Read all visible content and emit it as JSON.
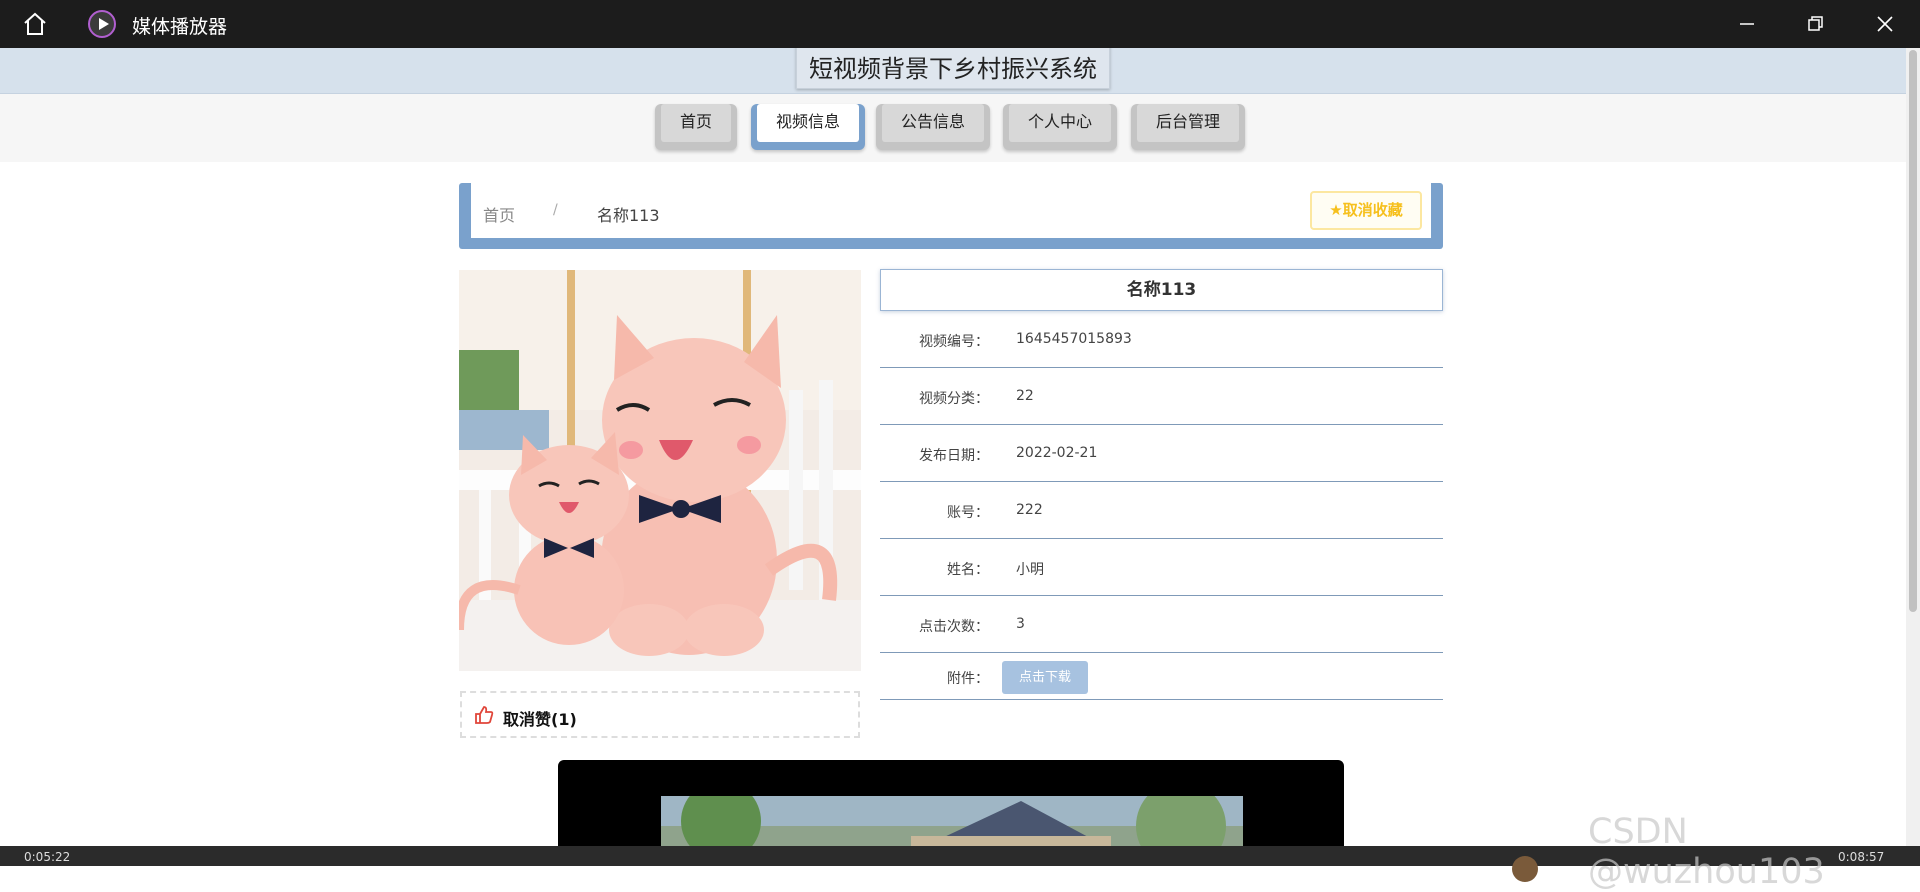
{
  "player": {
    "title": "媒体播放器",
    "icons": {
      "home": "home-icon",
      "app": "play-circle-icon",
      "minimize": "minimize-icon",
      "maximize": "restore-icon",
      "close": "close-icon"
    },
    "time_left": "0:05:22",
    "time_right": "0:08:57"
  },
  "site": {
    "title": "短视频背景下乡村振兴系统"
  },
  "nav": {
    "items": [
      {
        "label": "首页",
        "active": false
      },
      {
        "label": "视频信息",
        "active": true
      },
      {
        "label": "公告信息",
        "active": false
      },
      {
        "label": "个人中心",
        "active": false
      },
      {
        "label": "后台管理",
        "active": false
      }
    ]
  },
  "breadcrumb": {
    "home": "首页",
    "separator": "/",
    "current": "名称113"
  },
  "favorite": {
    "label": "取消收藏",
    "icon": "star-icon",
    "color": "#f6c01e"
  },
  "like": {
    "label": "取消赞(1)",
    "icon": "thumbs-up-icon",
    "color": "#e0463a"
  },
  "detail": {
    "title": "名称113",
    "rows": [
      {
        "label": "视频编号：",
        "value": "1645457015893"
      },
      {
        "label": "视频分类：",
        "value": "22"
      },
      {
        "label": "发布日期：",
        "value": "2022-02-21"
      },
      {
        "label": "账号：",
        "value": "222"
      },
      {
        "label": "姓名：",
        "value": "小明"
      },
      {
        "label": "点击次数：",
        "value": "3"
      }
    ],
    "attachment": {
      "label": "附件：",
      "button": "点击下载"
    }
  },
  "watermark": "CSDN @wuzhou103",
  "colors": {
    "accent": "#7aa1cc",
    "header_bg": "#d6e1ec",
    "download_btn": "#a7c2e0"
  }
}
